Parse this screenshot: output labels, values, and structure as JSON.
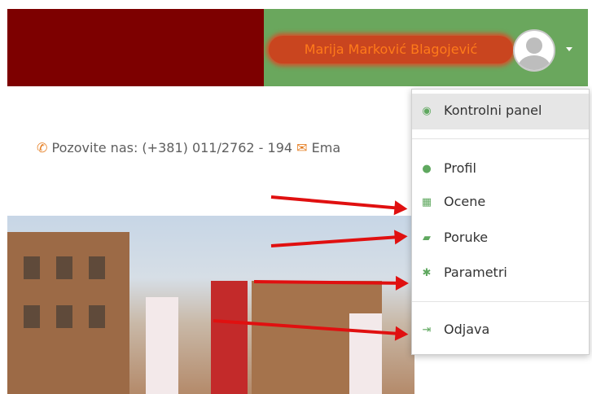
{
  "header": {
    "user_name": "Marija Marković Blagojević",
    "colors": {
      "left": "#7d0000",
      "right": "#6aa75d"
    }
  },
  "contact": {
    "phone_label": "Pozovite nas: (+381) 011/2762 - 194",
    "email_label": "Ema",
    "icon_phone": "phone-icon",
    "icon_email": "envelope-icon"
  },
  "menu": {
    "dashboard": "Kontrolni panel",
    "profile": "Profil",
    "grades": "Ocene",
    "messages": "Poruke",
    "preferences": "Parametri",
    "logout": "Odjava"
  }
}
